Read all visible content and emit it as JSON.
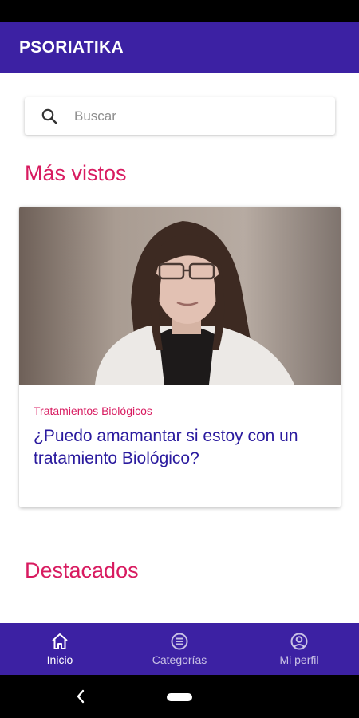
{
  "app": {
    "title": "PSORIATIKA"
  },
  "search": {
    "placeholder": "Buscar",
    "icon": "search-icon"
  },
  "sections": {
    "most_viewed": "Más vistos",
    "featured": "Destacados"
  },
  "card": {
    "category": "Tratamientos Biológicos",
    "title": "¿Puedo amamantar si estoy con un tratamiento Biológico?",
    "image": "video-thumbnail-doctor"
  },
  "bottom_nav": [
    {
      "label": "Inicio",
      "icon": "home-icon",
      "active": true
    },
    {
      "label": "Categorías",
      "icon": "list-icon",
      "active": false
    },
    {
      "label": "Mi perfil",
      "icon": "profile-icon",
      "active": false
    }
  ],
  "colors": {
    "primary": "#3c21a3",
    "accent": "#d81b60",
    "title_text": "#2a1a9e"
  }
}
